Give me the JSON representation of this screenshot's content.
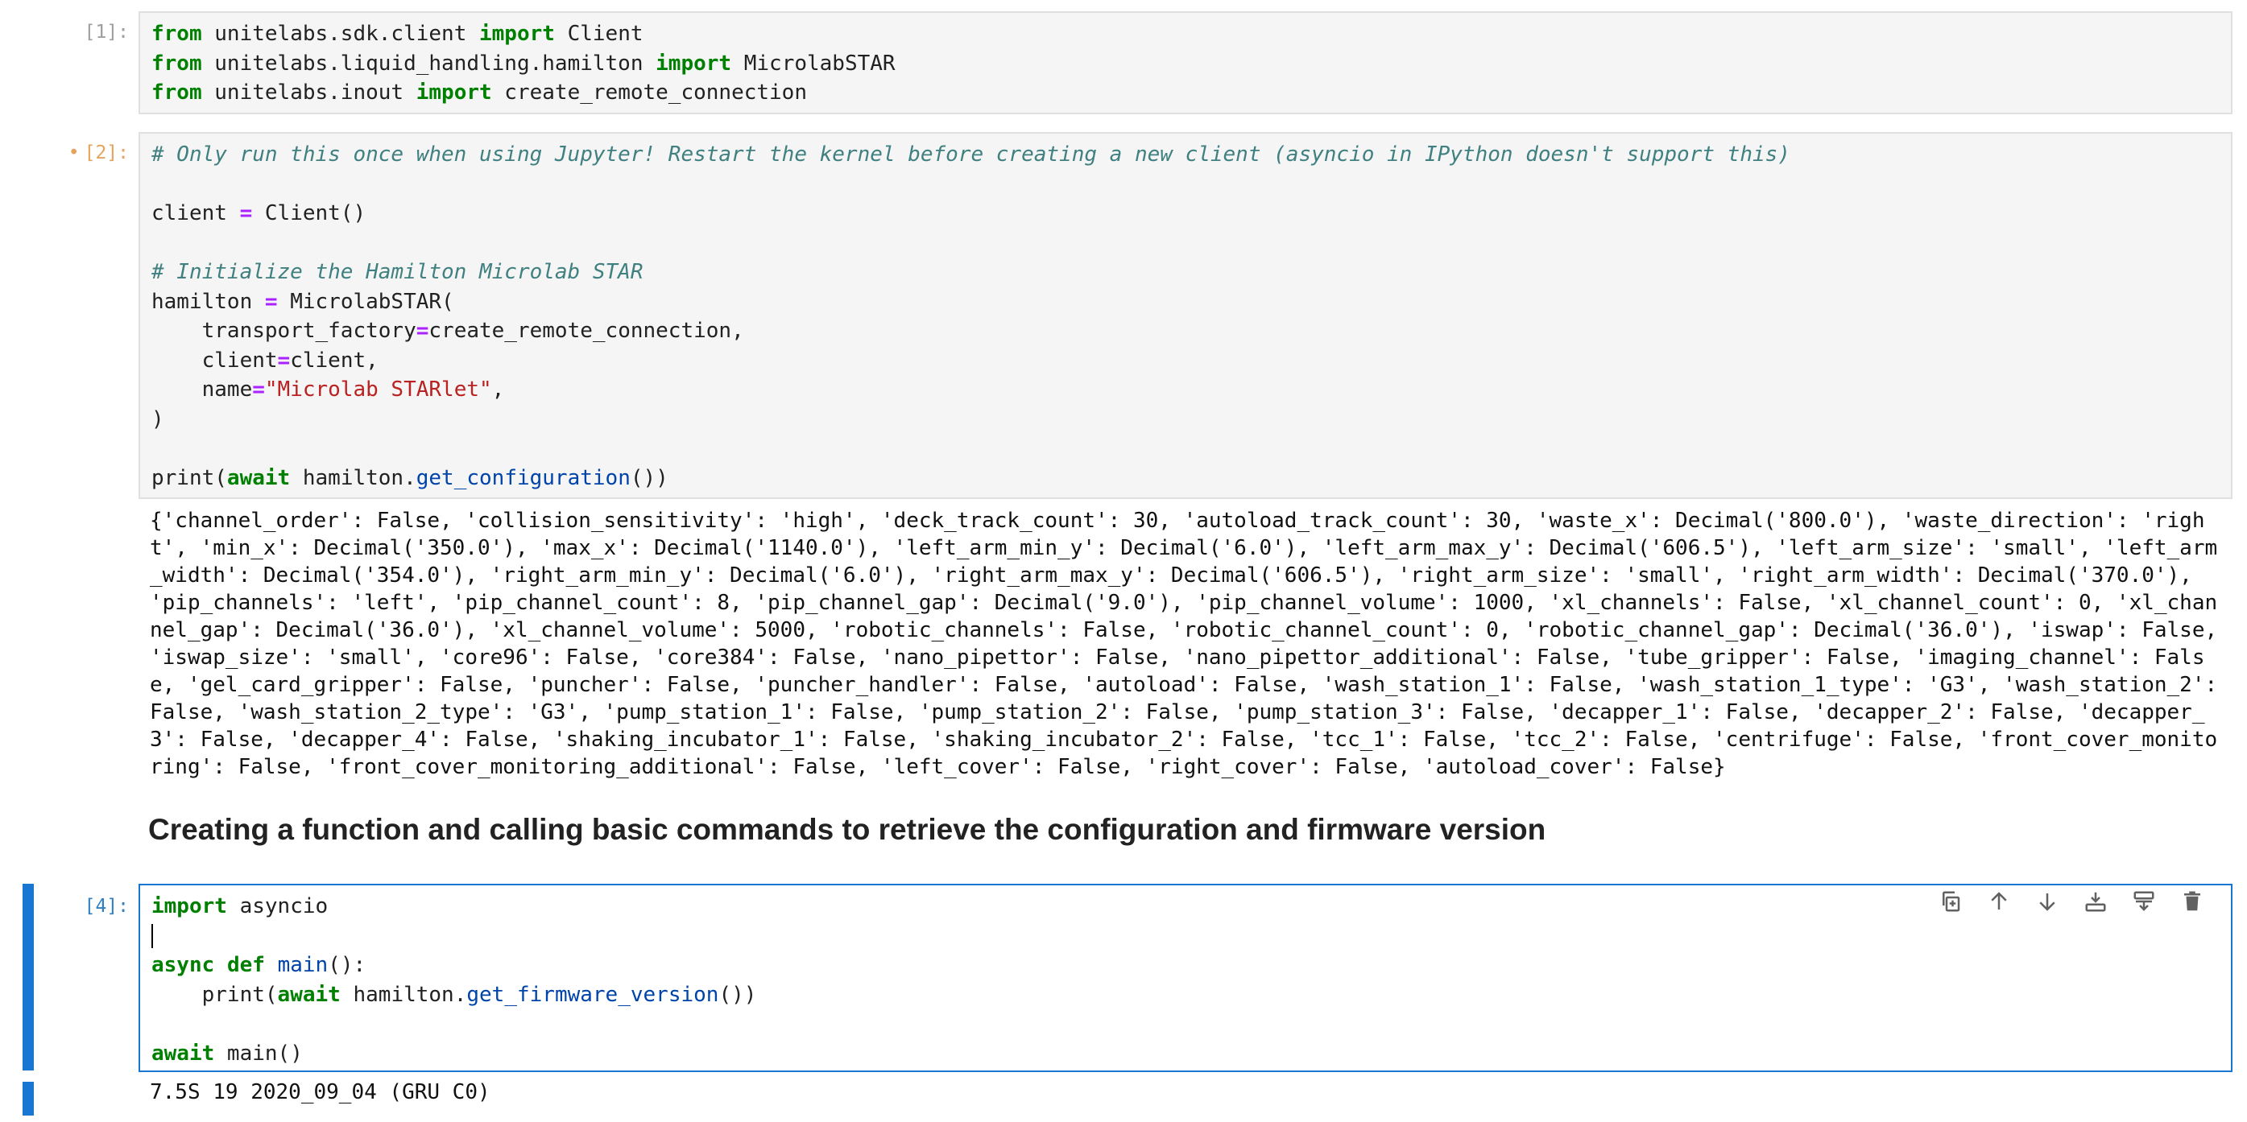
{
  "cells": [
    {
      "prompt": "[1]:",
      "lines": [
        [
          {
            "c": "kw",
            "t": "from"
          },
          {
            "c": "",
            "t": " unitelabs.sdk.client "
          },
          {
            "c": "kw",
            "t": "import"
          },
          {
            "c": "",
            "t": " Client"
          }
        ],
        [
          {
            "c": "kw",
            "t": "from"
          },
          {
            "c": "",
            "t": " unitelabs.liquid_handling.hamilton "
          },
          {
            "c": "kw",
            "t": "import"
          },
          {
            "c": "",
            "t": " MicrolabSTAR"
          }
        ],
        [
          {
            "c": "kw",
            "t": "from"
          },
          {
            "c": "",
            "t": " unitelabs.inout "
          },
          {
            "c": "kw",
            "t": "import"
          },
          {
            "c": "",
            "t": " create_remote_connection"
          }
        ]
      ]
    },
    {
      "prompt": "[2]:",
      "running_marker": "•",
      "lines": [
        [
          {
            "c": "cm",
            "t": "# Only run this once when using Jupyter! Restart the kernel before creating a new client (asyncio in IPython doesn't support this)"
          }
        ],
        [],
        [
          {
            "c": "",
            "t": "client "
          },
          {
            "c": "op",
            "t": "="
          },
          {
            "c": "",
            "t": " Client()"
          }
        ],
        [],
        [
          {
            "c": "cm",
            "t": "# Initialize the Hamilton Microlab STAR"
          }
        ],
        [
          {
            "c": "",
            "t": "hamilton "
          },
          {
            "c": "op",
            "t": "="
          },
          {
            "c": "",
            "t": " MicrolabSTAR("
          }
        ],
        [
          {
            "c": "",
            "t": "    transport_factory"
          },
          {
            "c": "op",
            "t": "="
          },
          {
            "c": "",
            "t": "create_remote_connection,"
          }
        ],
        [
          {
            "c": "",
            "t": "    client"
          },
          {
            "c": "op",
            "t": "="
          },
          {
            "c": "",
            "t": "client,"
          }
        ],
        [
          {
            "c": "",
            "t": "    name"
          },
          {
            "c": "op",
            "t": "="
          },
          {
            "c": "st",
            "t": "\"Microlab STARlet\""
          },
          {
            "c": "",
            "t": ","
          }
        ],
        [
          {
            "c": "",
            "t": ")"
          }
        ],
        [],
        [
          {
            "c": "",
            "t": "print("
          },
          {
            "c": "kw",
            "t": "await"
          },
          {
            "c": "",
            "t": " hamilton."
          },
          {
            "c": "fn",
            "t": "get_configuration"
          },
          {
            "c": "",
            "t": "())"
          }
        ]
      ],
      "output": "{'channel_order': False, 'collision_sensitivity': 'high', 'deck_track_count': 30, 'autoload_track_count': 30, 'waste_x': Decimal('800.0'), 'waste_direction': 'right', 'min_x': Decimal('350.0'), 'max_x': Decimal('1140.0'), 'left_arm_min_y': Decimal('6.0'), 'left_arm_max_y': Decimal('606.5'), 'left_arm_size': 'small', 'left_arm_width': Decimal('354.0'), 'right_arm_min_y': Decimal('6.0'), 'right_arm_max_y': Decimal('606.5'), 'right_arm_size': 'small', 'right_arm_width': Decimal('370.0'), 'pip_channels': 'left', 'pip_channel_count': 8, 'pip_channel_gap': Decimal('9.0'), 'pip_channel_volume': 1000, 'xl_channels': False, 'xl_channel_count': 0, 'xl_channel_gap': Decimal('36.0'), 'xl_channel_volume': 5000, 'robotic_channels': False, 'robotic_channel_count': 0, 'robotic_channel_gap': Decimal('36.0'), 'iswap': False, 'iswap_size': 'small', 'core96': False, 'core384': False, 'nano_pipettor': False, 'nano_pipettor_additional': False, 'tube_gripper': False, 'imaging_channel': False, 'gel_card_gripper': False, 'puncher': False, 'puncher_handler': False, 'autoload': False, 'wash_station_1': False, 'wash_station_1_type': 'G3', 'wash_station_2': False, 'wash_station_2_type': 'G3', 'pump_station_1': False, 'pump_station_2': False, 'pump_station_3': False, 'decapper_1': False, 'decapper_2': False, 'decapper_3': False, 'decapper_4': False, 'shaking_incubator_1': False, 'shaking_incubator_2': False, 'tcc_1': False, 'tcc_2': False, 'centrifuge': False, 'front_cover_monitoring': False, 'front_cover_monitoring_additional': False, 'left_cover': False, 'right_cover': False, 'autoload_cover': False}"
    },
    {
      "heading": "Creating a function and calling basic commands to retrieve the configuration and firmware version"
    },
    {
      "prompt": "[4]:",
      "lines": [
        [
          {
            "c": "kw",
            "t": "import"
          },
          {
            "c": "",
            "t": " asyncio"
          }
        ],
        [
          {
            "c": "cursor",
            "t": ""
          }
        ],
        [
          {
            "c": "kw",
            "t": "async"
          },
          {
            "c": "",
            "t": " "
          },
          {
            "c": "kw",
            "t": "def"
          },
          {
            "c": "",
            "t": " "
          },
          {
            "c": "fn",
            "t": "main"
          },
          {
            "c": "",
            "t": "():"
          }
        ],
        [
          {
            "c": "",
            "t": "    print("
          },
          {
            "c": "kw",
            "t": "await"
          },
          {
            "c": "",
            "t": " hamilton."
          },
          {
            "c": "fn",
            "t": "get_firmware_version"
          },
          {
            "c": "",
            "t": "())"
          }
        ],
        [],
        [
          {
            "c": "kw",
            "t": "await"
          },
          {
            "c": "",
            "t": " main()"
          }
        ]
      ],
      "output": "7.5S 19 2020_09_04 (GRU C0)",
      "toolbar": [
        "duplicate-icon",
        "move-up-icon",
        "move-down-icon",
        "insert-below-icon",
        "insert-above-icon",
        "delete-icon"
      ]
    }
  ],
  "colors": {
    "keyword": "#008000",
    "comment": "#408080",
    "operator": "#aa22ff",
    "string": "#ba2121",
    "function": "#0044aa",
    "active_border": "#1976d2",
    "running_prompt": "#e7a35b"
  }
}
